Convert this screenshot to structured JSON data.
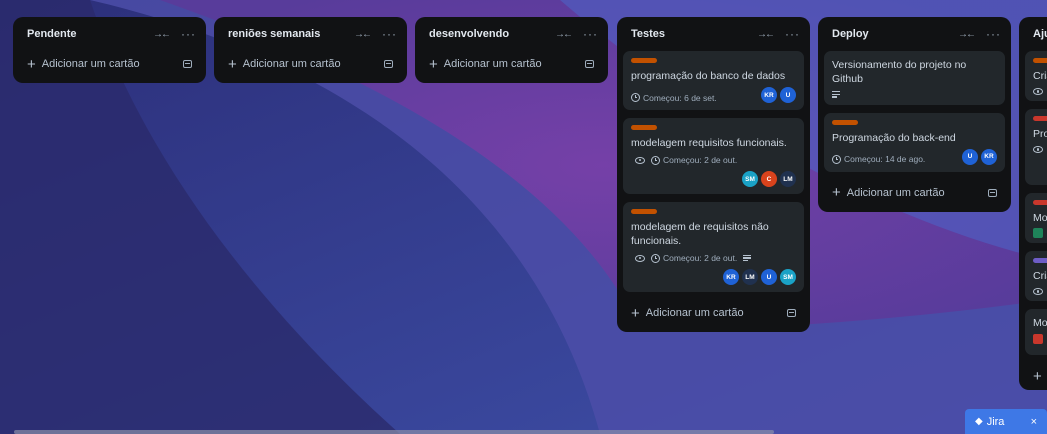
{
  "lists": [
    {
      "title": "Pendente",
      "add_label": "Adicionar um cartão"
    },
    {
      "title": "reniões semanais",
      "add_label": "Adicionar um cartão"
    },
    {
      "title": "desenvolvendo",
      "add_label": "Adicionar um cartão"
    },
    {
      "title": "Testes",
      "add_label": "Adicionar um cartão",
      "cards": [
        {
          "title": "programação do banco de dados",
          "date": "Começou: 6 de set.",
          "members": [
            "KR",
            "U"
          ]
        },
        {
          "title": "modelagem requisitos funcionais.",
          "date": "Começou: 2 de out.",
          "members": [
            "SM",
            "C",
            "LM"
          ]
        },
        {
          "title": "modelagem de requisitos não funcionais.",
          "date": "Começou: 2 de out.",
          "members": [
            "KR",
            "LM",
            "U",
            "SM"
          ]
        }
      ]
    },
    {
      "title": "Deploy",
      "add_label": "Adicionar um cartão",
      "cards": [
        {
          "title": "Versionamento do projeto no Github"
        },
        {
          "title": "Programação do back-end",
          "date": "Começou: 14 de ago.",
          "members": [
            "U",
            "KR"
          ]
        }
      ]
    },
    {
      "title": "Aju",
      "card_snippets": [
        "Cria",
        "Pro",
        "Mo",
        "Cria",
        "Mo"
      ]
    }
  ],
  "colors": {
    "KR": "#1f62d6",
    "U": "#1f62d6",
    "SM": "#1aa2c6",
    "C": "#d9431c",
    "LM": "#20314f",
    "label_orange": "#c25100",
    "label_red": "#c9372c",
    "label_purple": "#6e5dc6",
    "label_green": "#1f845a",
    "jira_blue": "#3e78e6"
  },
  "jira": {
    "label": "Jira",
    "close": "×"
  }
}
